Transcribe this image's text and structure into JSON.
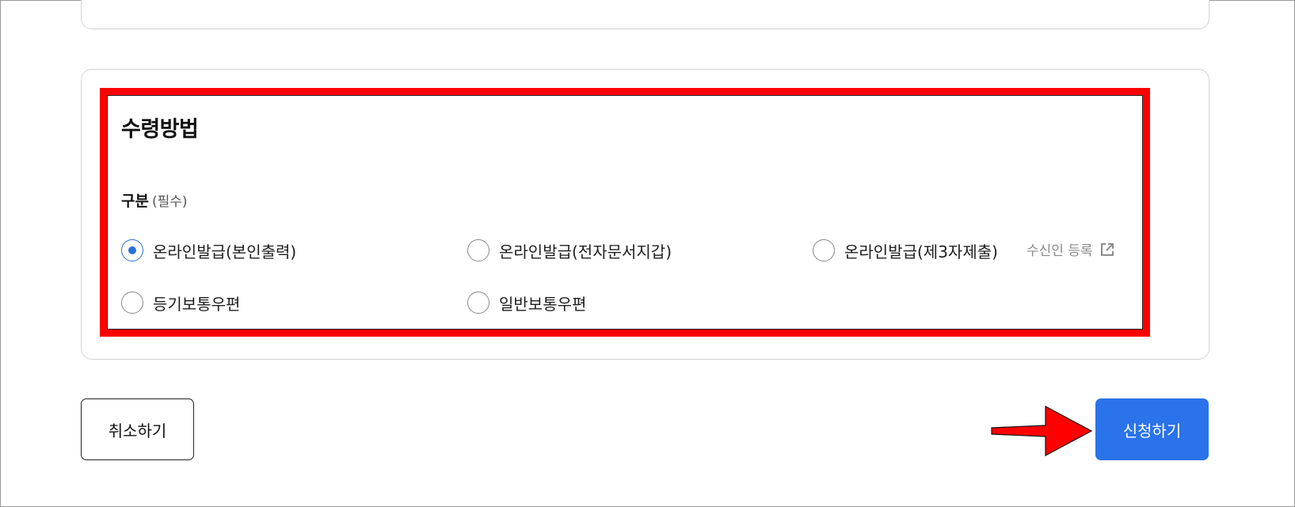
{
  "section": {
    "title": "수령방법",
    "field_label": "구분",
    "required_label": "(필수)"
  },
  "options": [
    {
      "label": "온라인발급(본인출력)",
      "checked": true
    },
    {
      "label": "온라인발급(전자문서지갑)",
      "checked": false
    },
    {
      "label": "온라인발급(제3자제출)",
      "checked": false
    },
    {
      "label": "등기보통우편",
      "checked": false
    },
    {
      "label": "일반보통우편",
      "checked": false
    }
  ],
  "recipient_link": {
    "label": "수신인 등록",
    "icon": "external-link-icon"
  },
  "actions": {
    "cancel_label": "취소하기",
    "submit_label": "신청하기"
  },
  "colors": {
    "accent": "#2a73ea",
    "radio_checked": "#2a6fd6",
    "highlight_border": "#ff0000",
    "arrow": "#ff0000"
  }
}
